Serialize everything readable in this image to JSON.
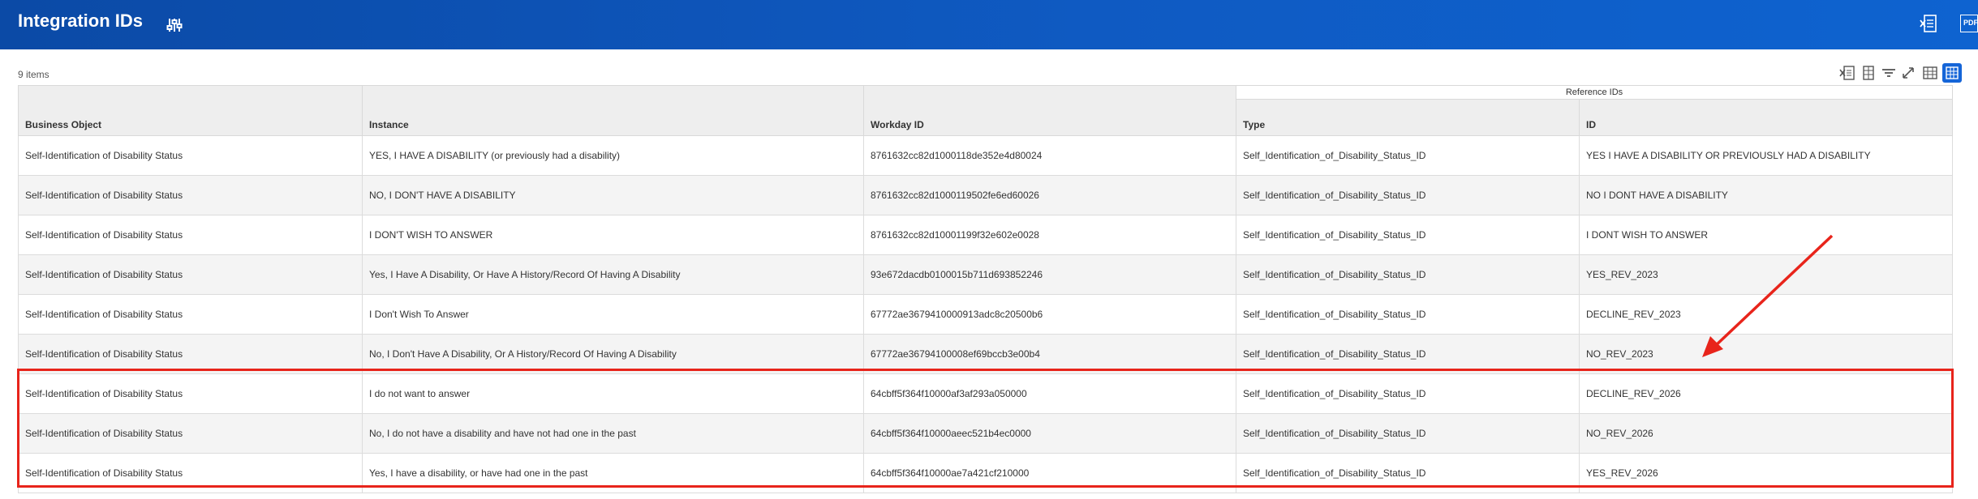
{
  "header": {
    "title": "Integration IDs",
    "actions": [
      {
        "icon": "excel-export-icon"
      },
      {
        "icon": "pdf-export-icon",
        "label": "PDF"
      }
    ]
  },
  "summary": {
    "item_count": "9 items"
  },
  "toolbar": {
    "icons": [
      "export-to-excel-icon",
      "export-to-worksheets-icon",
      "filter-icon",
      "fullscreen-icon",
      "table-view-icon",
      "grid-view-icon"
    ]
  },
  "table": {
    "group_header": "Reference IDs",
    "columns": [
      "Business Object",
      "Instance",
      "Workday ID",
      "Type",
      "ID"
    ],
    "rows": [
      [
        "Self-Identification of Disability Status",
        "YES, I HAVE A DISABILITY (or previously had a disability)",
        "8761632cc82d1000118de352e4d80024",
        "Self_Identification_of_Disability_Status_ID",
        "YES I HAVE A DISABILITY OR PREVIOUSLY HAD A DISABILITY"
      ],
      [
        "Self-Identification of Disability Status",
        "NO, I DON'T HAVE A DISABILITY",
        "8761632cc82d1000119502fe6ed60026",
        "Self_Identification_of_Disability_Status_ID",
        "NO I DONT HAVE A DISABILITY"
      ],
      [
        "Self-Identification of Disability Status",
        "I DON'T WISH TO ANSWER",
        "8761632cc82d10001199f32e602e0028",
        "Self_Identification_of_Disability_Status_ID",
        "I DONT WISH TO ANSWER"
      ],
      [
        "Self-Identification of Disability Status",
        "Yes, I Have A Disability, Or Have A History/Record Of Having A Disability",
        "93e672dacdb0100015b711d693852246",
        "Self_Identification_of_Disability_Status_ID",
        "YES_REV_2023"
      ],
      [
        "Self-Identification of Disability Status",
        "I Don't Wish To Answer",
        "67772ae3679410000913adc8c20500b6",
        "Self_Identification_of_Disability_Status_ID",
        "DECLINE_REV_2023"
      ],
      [
        "Self-Identification of Disability Status",
        "No, I Don't Have A Disability, Or A History/Record Of Having A Disability",
        "67772ae36794100008ef69bccb3e00b4",
        "Self_Identification_of_Disability_Status_ID",
        "NO_REV_2023"
      ],
      [
        "Self-Identification of Disability Status",
        "I do not want to answer",
        "64cbff5f364f10000af3af293a050000",
        "Self_Identification_of_Disability_Status_ID",
        "DECLINE_REV_2026"
      ],
      [
        "Self-Identification of Disability Status",
        "No, I do not have a disability and have not had one in the past",
        "64cbff5f364f10000aeec521b4ec0000",
        "Self_Identification_of_Disability_Status_ID",
        "NO_REV_2026"
      ],
      [
        "Self-Identification of Disability Status",
        "Yes, I have a disability, or have had one in the past",
        "64cbff5f364f10000ae7a421cf210000",
        "Self_Identification_of_Disability_Status_ID",
        "YES_REV_2026"
      ]
    ]
  },
  "annotation": {
    "color": "#e8241b"
  }
}
